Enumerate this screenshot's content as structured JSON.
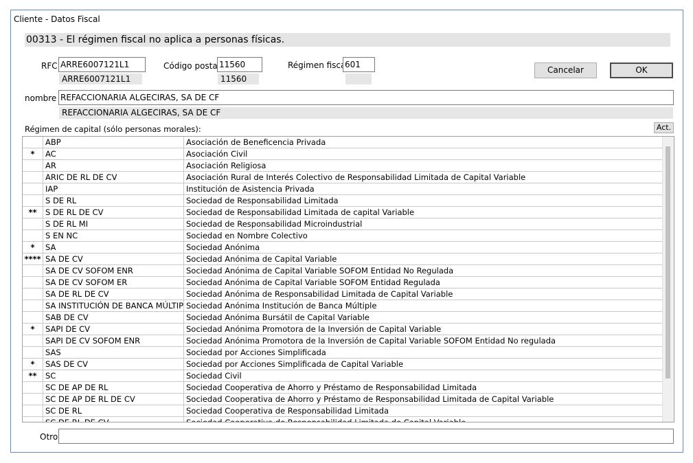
{
  "window": {
    "title": "Cliente - Datos Fiscal"
  },
  "banner": "00313 - El régimen fiscal no aplica a personas físicas.",
  "form": {
    "rfc_label": "RFC:",
    "rfc_value": "ARRE6007121L1",
    "rfc_echo": "ARRE6007121L1",
    "cp_label": "Código postal:",
    "cp_value": "11560",
    "cp_echo": "11560",
    "regimen_label": "Régimen fiscal:",
    "regimen_value": "601",
    "regimen_echo": "",
    "nombre_label": "nombre",
    "nombre_value": "REFACCIONARIA ALGECIRAS, SA DE CF",
    "nombre_echo": "REFACCIONARIA ALGECIRAS, SA DE CF",
    "capital_label": "Régimen de capital (sólo personas morales):",
    "act_label": "Act.",
    "otro_label": "Otro:",
    "otro_value": ""
  },
  "buttons": {
    "cancel": "Cancelar",
    "ok": "OK"
  },
  "table_rows": [
    {
      "mark": "",
      "code": "ABP",
      "desc": "Asociación de Beneficencia Privada"
    },
    {
      "mark": "*",
      "code": "AC",
      "desc": "Asociación Civil"
    },
    {
      "mark": "",
      "code": "AR",
      "desc": "Asociación Religiosa"
    },
    {
      "mark": "",
      "code": "ARIC DE RL DE CV",
      "desc": "Asociación Rural de Interés Colectivo de Responsabilidad Limitada de Capital Variable"
    },
    {
      "mark": "",
      "code": "IAP",
      "desc": "Institución de Asistencia Privada"
    },
    {
      "mark": "",
      "code": "S DE RL",
      "desc": "Sociedad de Responsabilidad Limitada"
    },
    {
      "mark": "**",
      "code": "S DE RL DE CV",
      "desc": "Sociedad de Responsabilidad Limitada de capital Variable"
    },
    {
      "mark": "",
      "code": "S DE RL MI",
      "desc": "Sociedad de Responsabilidad Microindustrial"
    },
    {
      "mark": "",
      "code": "S EN NC",
      "desc": "Sociedad en Nombre Colectivo"
    },
    {
      "mark": "*",
      "code": "SA",
      "desc": "Sociedad Anónima"
    },
    {
      "mark": "****",
      "code": "SA DE CV",
      "desc": "Sociedad Anónima de Capital Variable"
    },
    {
      "mark": "",
      "code": "SA DE CV SOFOM ENR",
      "desc": "Sociedad Anónima de Capital Variable SOFOM Entidad No Regulada"
    },
    {
      "mark": "",
      "code": "SA DE CV SOFOM ER",
      "desc": "Sociedad Anónima de Capital Variable SOFOM Entidad Regulada"
    },
    {
      "mark": "",
      "code": "SA DE RL DE CV",
      "desc": "Sociedad Anónima de Responsabilidad Limitada de Capital Variable"
    },
    {
      "mark": "",
      "code": "SA INSTITUCIÓN DE BANCA MÚLTIPLE",
      "desc": "Sociedad Anónima Institución de Banca Múltiple"
    },
    {
      "mark": "",
      "code": "SAB DE CV",
      "desc": "Sociedad Anónima Bursátil de Capital Variable"
    },
    {
      "mark": "*",
      "code": "SAPI DE CV",
      "desc": "Sociedad Anónima Promotora de la Inversión de Capital Variable"
    },
    {
      "mark": "",
      "code": "SAPI DE CV SOFOM ENR",
      "desc": "Sociedad Anónima Promotora de la Inversión de Capital Variable SOFOM Entidad No regulada"
    },
    {
      "mark": "",
      "code": "SAS",
      "desc": "Sociedad por Acciones Simplificada"
    },
    {
      "mark": "*",
      "code": "SAS DE CV",
      "desc": "Sociedad por Acciones Simplificada de Capital Variable"
    },
    {
      "mark": "**",
      "code": "SC",
      "desc": "Sociedad Civil"
    },
    {
      "mark": "",
      "code": "SC DE AP DE RL",
      "desc": "Sociedad Cooperativa de Ahorro y Préstamo de Responsabilidad Limitada"
    },
    {
      "mark": "",
      "code": "SC DE AP DE RL DE CV",
      "desc": "Sociedad Cooperativa de Ahorro y Préstamo de Responsabilidad Limitada de Capital Variable"
    },
    {
      "mark": "",
      "code": "SC DE RL",
      "desc": "Sociedad Cooperativa de Responsabilidad Limitada"
    },
    {
      "mark": "",
      "code": "SC DE RL DE CV",
      "desc": "Sociedad Cooperativa de Responsabilidad Limitada de Capital Variable"
    }
  ]
}
